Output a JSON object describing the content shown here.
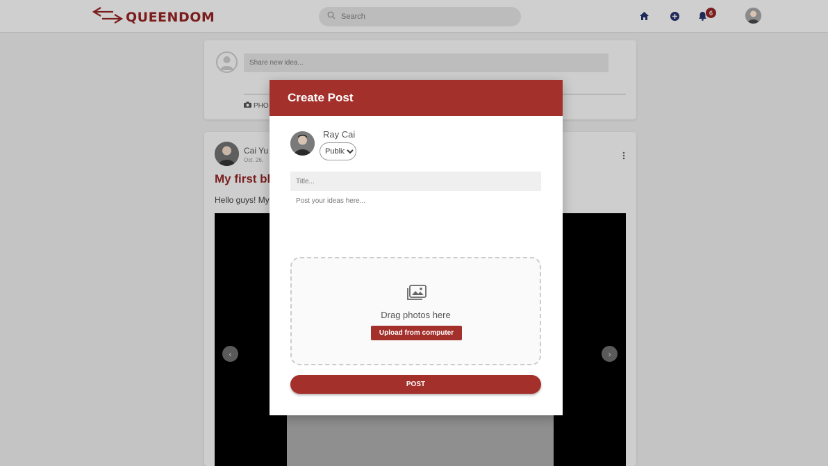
{
  "header": {
    "logo_text": "QUEENDOM",
    "search_placeholder": "Search",
    "notification_count": "6"
  },
  "composer": {
    "placeholder": "Share new idea...",
    "photo_label": "PHO"
  },
  "post": {
    "author": "Cai Yu",
    "date": "Oct. 26,",
    "title": "My first bl",
    "body": "Hello guys! My"
  },
  "modal": {
    "title": "Create Post",
    "user_name": "Ray Cai",
    "privacy_selected": "Public",
    "title_placeholder": "Title...",
    "content_placeholder": "Post your ideas here...",
    "drop_text": "Drag photos here",
    "upload_label": "Upload from computer",
    "post_label": "POST"
  },
  "colors": {
    "brand_red": "#a4302c",
    "logo_red": "#7c1d1d",
    "nav_icon": "#1f2a5a"
  }
}
